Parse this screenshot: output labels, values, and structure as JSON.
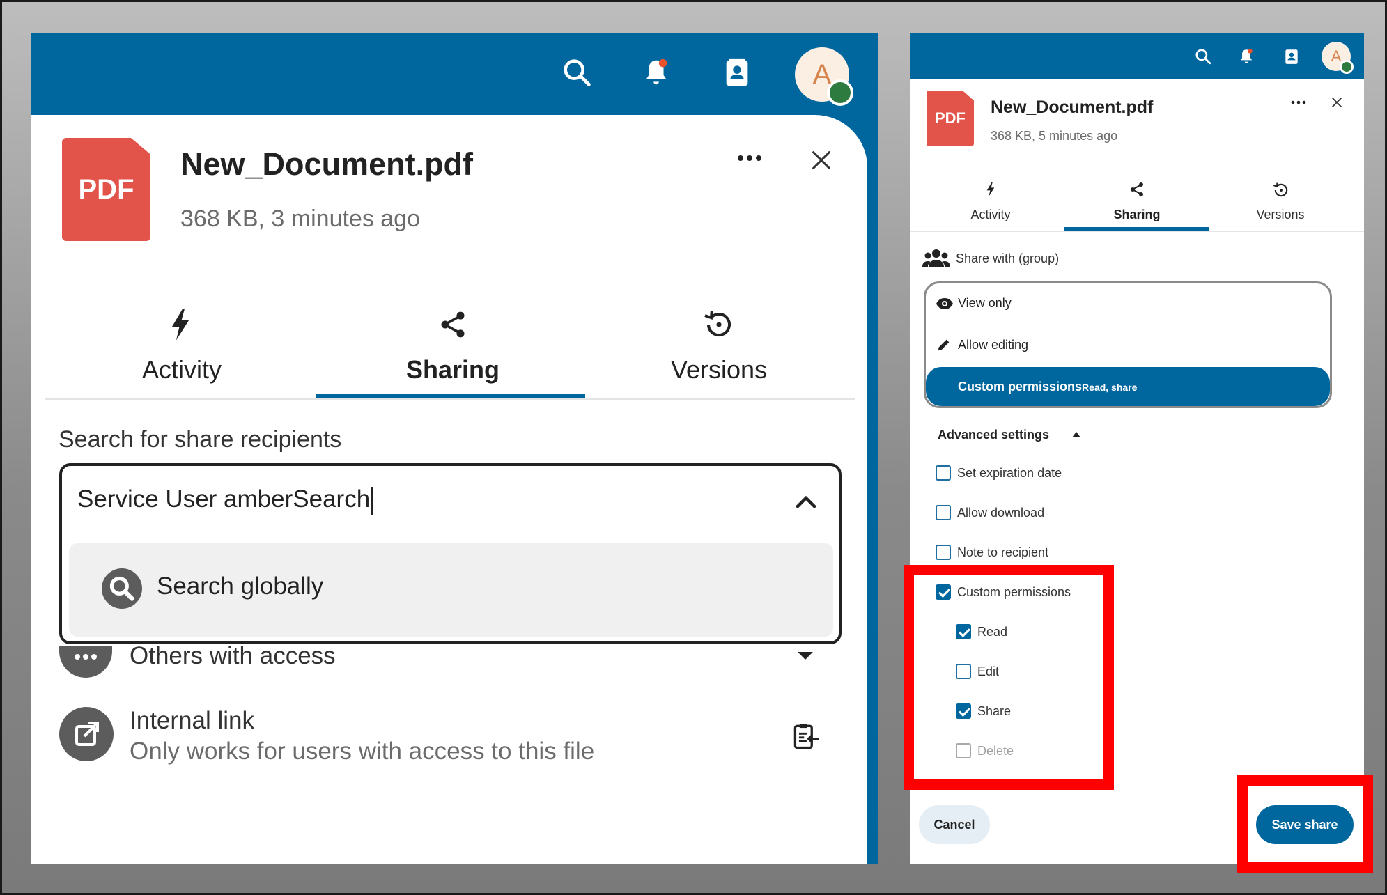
{
  "left": {
    "file": {
      "icon_label": "PDF",
      "name": "New_Document.pdf",
      "meta": "368 KB, 3 minutes ago"
    },
    "tabs": [
      {
        "label": "Activity",
        "icon": "lightning-icon"
      },
      {
        "label": "Sharing",
        "icon": "share-icon"
      },
      {
        "label": "Versions",
        "icon": "history-icon"
      }
    ],
    "avatar_letter": "A",
    "search": {
      "label": "Search for share recipients",
      "value": "Service User amberSearch",
      "option": "Search globally"
    },
    "others": {
      "label": "Others with access"
    },
    "internal_link": {
      "title": "Internal link",
      "subtitle": "Only works for users with access to this file"
    }
  },
  "right": {
    "file": {
      "icon_label": "PDF",
      "name": "New_Document.pdf",
      "meta": "368 KB, 5 minutes ago"
    },
    "tabs": [
      {
        "label": "Activity",
        "icon": "lightning-icon"
      },
      {
        "label": "Sharing",
        "icon": "share-icon"
      },
      {
        "label": "Versions",
        "icon": "history-icon"
      }
    ],
    "avatar_letter": "A",
    "share_with": "Share with (group)",
    "permissions": {
      "view_only": "View only",
      "allow_editing": "Allow editing",
      "custom": "Custom permissions",
      "custom_sub": "Read, share"
    },
    "advanced_settings": "Advanced settings",
    "options": [
      {
        "label": "Set expiration date",
        "checked": false
      },
      {
        "label": "Allow download",
        "checked": false
      },
      {
        "label": "Note to recipient",
        "checked": false
      },
      {
        "label": "Custom permissions",
        "checked": true
      }
    ],
    "custom_perms": [
      {
        "label": "Read",
        "checked": true
      },
      {
        "label": "Edit",
        "checked": false
      },
      {
        "label": "Share",
        "checked": true
      },
      {
        "label": "Delete",
        "checked": false,
        "disabled": true
      }
    ],
    "cancel": "Cancel",
    "save": "Save share"
  },
  "colors": {
    "brand": "#00679e",
    "pdf": "#e2534a",
    "highlight": "#ff0000",
    "status_online": "#2d7b3f"
  }
}
